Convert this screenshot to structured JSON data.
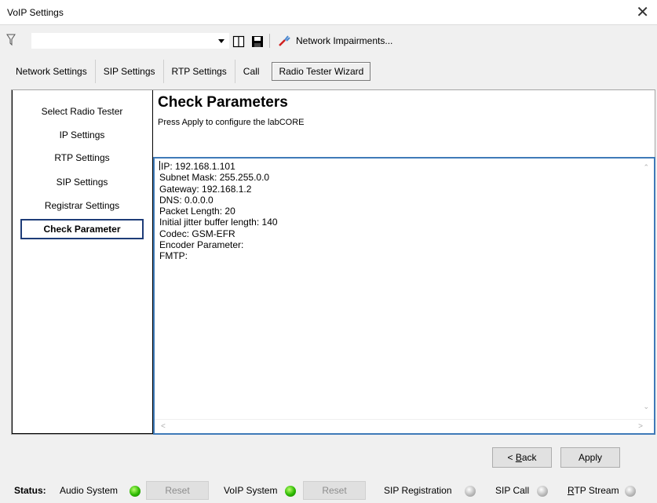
{
  "window": {
    "title": "VoIP Settings",
    "close_glyph": "✕"
  },
  "toolbar": {
    "combo_value": "",
    "impairments_label": "Network Impairments..."
  },
  "tabs": [
    {
      "label": "Network Settings"
    },
    {
      "label": "SIP Settings"
    },
    {
      "label": "RTP Settings"
    },
    {
      "label": "Call"
    },
    {
      "label": "Radio Tester Wizard"
    }
  ],
  "sidebar": {
    "items": [
      {
        "label": "Select Radio Tester"
      },
      {
        "label": "IP Settings"
      },
      {
        "label": "RTP Settings"
      },
      {
        "label": "SIP Settings"
      },
      {
        "label": "Registrar Settings"
      },
      {
        "label": "Check Parameter"
      }
    ]
  },
  "header": {
    "title": "Check Parameters",
    "subtitle": "Press Apply to configure the labCORE"
  },
  "details": {
    "lines": [
      "IP: 192.168.1.101",
      "Subnet Mask: 255.255.0.0",
      "Gateway: 192.168.1.2",
      "DNS: 0.0.0.0",
      "Packet Length: 20",
      "Initial jitter buffer length: 140",
      "Codec: GSM-EFR",
      "Encoder Parameter:",
      "FMTP:"
    ]
  },
  "buttons": {
    "back_prefix": "< ",
    "back_key": "B",
    "back_rest": "ack",
    "apply": "Apply"
  },
  "status": {
    "label": "Status:",
    "audio_system": "Audio System",
    "reset1": "Reset",
    "voip_system": "VoIP System",
    "reset2": "Reset",
    "sip_registration": "SIP Registration",
    "sip_call": "SIP Call",
    "rtp_key": "R",
    "rtp_rest": "TP Stream"
  },
  "colors": {
    "accent": "#3f7ab8",
    "active_border": "#1e3c78",
    "led_on": "#2bb800",
    "led_off": "#bdbdbd"
  }
}
